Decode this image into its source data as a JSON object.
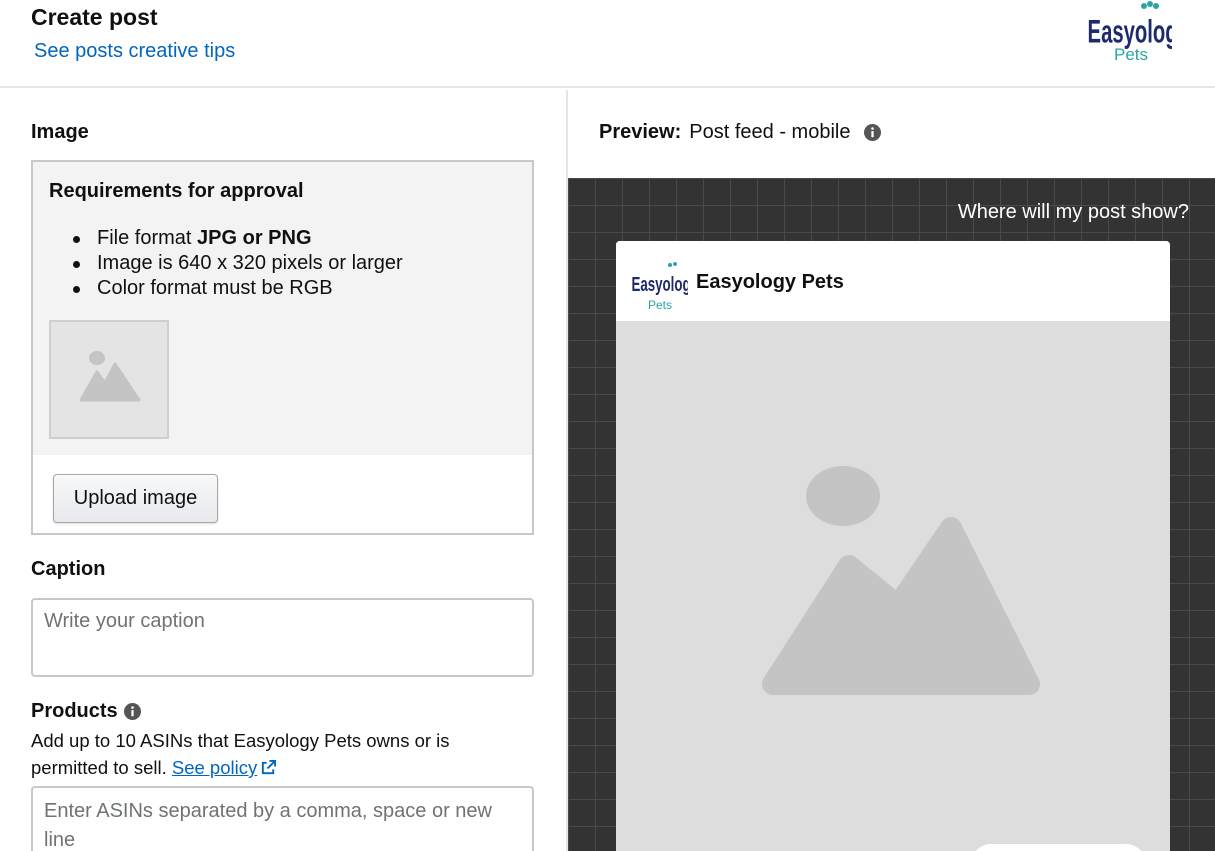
{
  "header": {
    "title": "Create post",
    "tips_link": "See posts creative tips",
    "logo": {
      "icon": "brand-logo-icon",
      "text_top": "Easyology",
      "text_bottom": "Pets"
    }
  },
  "image_section": {
    "label": "Image",
    "requirements_title": "Requirements for approval",
    "requirements": [
      {
        "prefix": "File format ",
        "bold": "JPG or PNG"
      },
      {
        "prefix": "Image is 640 x 320 pixels or larger",
        "bold": ""
      },
      {
        "prefix": "Color format must be RGB",
        "bold": ""
      }
    ],
    "placeholder_icon": "image-placeholder-icon",
    "upload_button": "Upload image"
  },
  "caption_section": {
    "label": "Caption",
    "placeholder": "Write your caption"
  },
  "products_section": {
    "label": "Products",
    "info_icon": "info-icon",
    "help_text": "Add up to 10 ASINs that Easyology Pets owns or is permitted to sell.",
    "policy_link": "See policy",
    "external_icon": "external-link-icon",
    "placeholder": "Enter ASINs separated by a comma, space or new line"
  },
  "preview": {
    "label_bold": "Preview:",
    "label_value": "Post feed - mobile",
    "info_icon": "info-icon",
    "where_link": "Where will my post show?",
    "card": {
      "brand_name": "Easyology Pets",
      "media_icon": "image-placeholder-icon"
    }
  },
  "colors": {
    "link": "#0066c0",
    "canvas_bg": "#333333",
    "placeholder_gray": "#dddddd",
    "logo_navy": "#1f2a6b",
    "logo_teal": "#2aa6a0"
  }
}
